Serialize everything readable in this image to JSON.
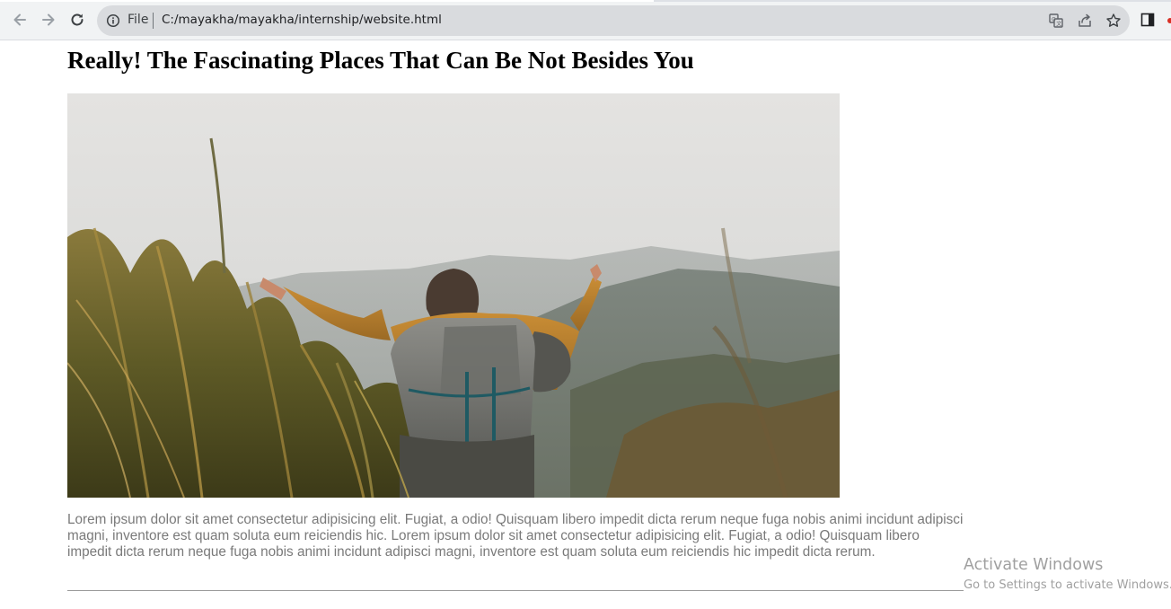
{
  "browser": {
    "scheme_label": "File",
    "url": "C:/mayakha/mayakha/internship/website.html",
    "icons": {
      "back": "arrow-left-icon",
      "forward": "arrow-right-icon",
      "reload": "reload-icon",
      "info": "info-icon",
      "translate": "translate-icon",
      "share": "share-icon",
      "bookmark": "star-icon",
      "side_panel": "side-panel-icon"
    }
  },
  "article": {
    "title": "Really! The Fascinating Places That Can Be Not Besides You",
    "image_subject": "hiker-with-backpack-mountain-photo",
    "body": "Lorem ipsum dolor sit amet consectetur adipisicing elit. Fugiat, a odio! Quisquam libero impedit dicta rerum neque fuga nobis animi incidunt adipisci magni, inventore est quam soluta eum reiciendis hic. Lorem ipsum dolor sit amet consectetur adipisicing elit. Fugiat, a odio! Quisquam libero impedit dicta rerum neque fuga nobis animi incidunt adipisci magni, inventore est quam soluta eum reiciendis hic impedit dicta rerum."
  },
  "os_watermark": {
    "title": "Activate Windows",
    "subtitle": "Go to Settings to activate Windows."
  },
  "colors": {
    "toolbar_bg": "#f1f3f4",
    "omnibox_bg": "#d9dbde",
    "body_text": "#7a7a7a",
    "title_text": "#000000"
  }
}
